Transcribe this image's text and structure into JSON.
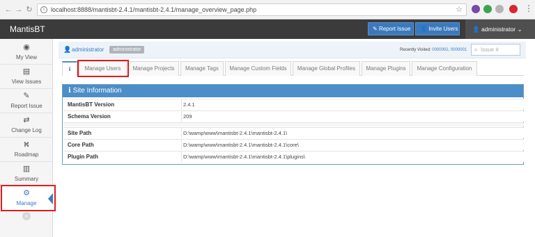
{
  "browser": {
    "url": "localhost:8888/mantisbt-2.4.1/mantisbt-2.4.1/manage_overview_page.php",
    "back_icon": "arrow-left",
    "forward_icon": "arrow-right",
    "reload_icon": "reload",
    "star_icon": "star",
    "menu_icon": "more-vertical"
  },
  "navbar": {
    "brand": "MantisBT",
    "report_issue_label": "Report Issue",
    "invite_users_label": "Invite Users",
    "user_label": "administrator"
  },
  "sidebar": {
    "items": [
      {
        "label": "My View",
        "icon": "dashboard"
      },
      {
        "label": "View Issues",
        "icon": "list"
      },
      {
        "label": "Report Issue",
        "icon": "edit"
      },
      {
        "label": "Change Log",
        "icon": "retweet"
      },
      {
        "label": "Roadmap",
        "icon": "road"
      },
      {
        "label": "Summary",
        "icon": "bar-chart"
      },
      {
        "label": "Manage",
        "icon": "gears"
      }
    ]
  },
  "breadcrumb": {
    "user": "administrator",
    "role": "administrator",
    "recently_visited_label": "Recently Visited:",
    "recent_issues": "0000002, 0000001",
    "issue_placeholder": "Issue #"
  },
  "tabs": [
    {
      "label": "Manage Users"
    },
    {
      "label": "Manage Projects"
    },
    {
      "label": "Manage Tags"
    },
    {
      "label": "Manage Custom Fields"
    },
    {
      "label": "Manage Global Profiles"
    },
    {
      "label": "Manage Plugins"
    },
    {
      "label": "Manage Configuration"
    }
  ],
  "panel": {
    "title": "Site Information",
    "rows": [
      {
        "label": "MantisBT Version",
        "value": "2.4.1"
      },
      {
        "label": "Schema Version",
        "value": "209"
      },
      {
        "label": "Site Path",
        "value": "D:\\wamp\\www\\mantisbt-2.4.1\\mantisbt-2.4.1\\"
      },
      {
        "label": "Core Path",
        "value": "D:\\wamp\\www\\mantisbt-2.4.1\\mantisbt-2.4.1\\core\\"
      },
      {
        "label": "Plugin Path",
        "value": "D:\\wamp\\www\\mantisbt-2.4.1\\mantisbt-2.4.1\\plugins\\"
      }
    ]
  },
  "colors": {
    "accent": "#4b8ec8",
    "navbar": "#3b3b3b",
    "highlight": "#e21b1b"
  }
}
